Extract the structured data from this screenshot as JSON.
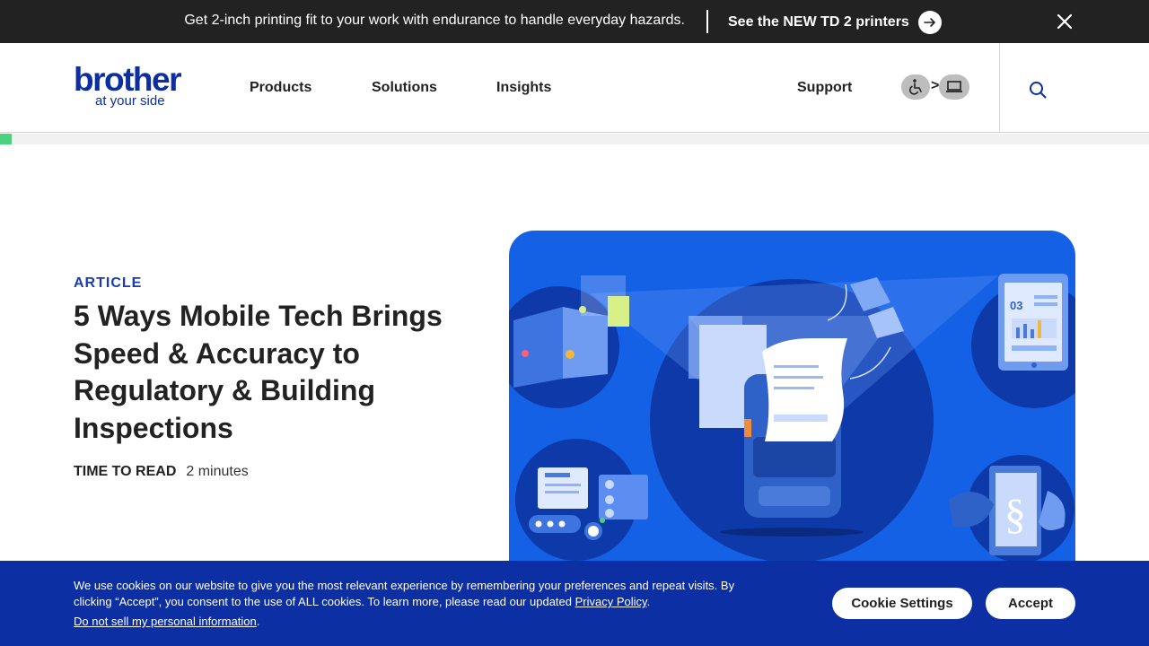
{
  "promo": {
    "text": "Get 2-inch printing fit to your work with endurance to handle everyday hazards.",
    "link": "See the NEW TD 2 printers"
  },
  "logo": {
    "word": "brother",
    "tagline": "at your side"
  },
  "nav": {
    "products": "Products",
    "solutions": "Solutions",
    "insights": "Insights",
    "support": "Support",
    "a11y_separator": ">"
  },
  "reading_progress": 0.01,
  "article": {
    "eyebrow": "ARTICLE",
    "title": "5 Ways Mobile Tech Brings Speed & Accuracy to Regulatory & Building Inspections",
    "time_label": "TIME TO READ",
    "time_value": "2 minutes"
  },
  "hero": {
    "tablet_number": "03",
    "legal_symbol": "§"
  },
  "cookie": {
    "text_before": "We use cookies on our website to give you the most relevant experience by remembering your preferences and repeat visits. By clicking “Accept”, you consent to the use of ALL cookies. To learn more, please read our updated ",
    "privacy_link": "Privacy Policy",
    "text_after": ".",
    "dns_link": "Do not sell my personal information",
    "dns_after": ".",
    "settings_button": "Cookie Settings",
    "accept_button": "Accept"
  },
  "colors": {
    "brand_blue": "#0d2ea0",
    "hero_blue": "#1561e6",
    "cookie_bg": "#0c2fa3",
    "progress_green": "#4cd27e",
    "promo_bg": "#222222"
  }
}
